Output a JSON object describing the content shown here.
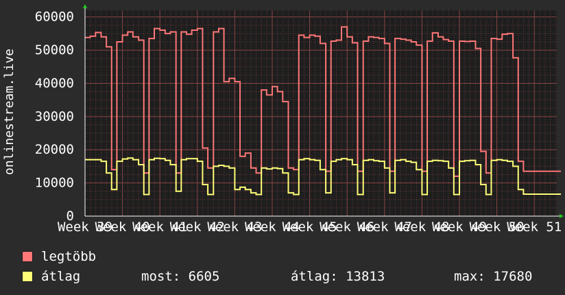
{
  "ylabel": "onlinestream.live",
  "x_tick_labels": [
    "Week 39",
    "Week 40",
    "Week 41",
    "Week 42",
    "Week 43",
    "Week 44",
    "Week 45",
    "Week 46",
    "Week 47",
    "Week 48",
    "Week 49",
    "Week 50",
    "Week 51"
  ],
  "legend": {
    "items": [
      {
        "label": "legtöbb",
        "color": "#ff7777"
      },
      {
        "label": "átlag",
        "color": "#ffff77"
      }
    ],
    "stats": {
      "now": "most: 6605",
      "avg": "átlag: 13813",
      "max": "max: 17680"
    }
  },
  "colors": {
    "background": "#2b2b2b",
    "plot_background": "#1e1e1e",
    "grid": "#6b3a3a",
    "text": "#ffffff",
    "axis_arrow": "#22cc22"
  },
  "chart_data": {
    "type": "line",
    "xlabel": "",
    "ylabel": "onlinestream.live",
    "ylim": [
      0,
      62000
    ],
    "xlim": [
      0,
      12.6
    ],
    "x_unit": "weeks since start of Week 39",
    "y_ticks": [
      0,
      10000,
      20000,
      30000,
      40000,
      50000,
      60000
    ],
    "grid": true,
    "legend_position": "bottom",
    "series": [
      {
        "name": "legtöbb",
        "color": "#ff7777",
        "x": [
          0.0,
          0.14,
          0.28,
          0.43,
          0.57,
          0.71,
          0.85,
          1.0,
          1.14,
          1.28,
          1.43,
          1.57,
          1.71,
          1.85,
          2.0,
          2.14,
          2.28,
          2.43,
          2.57,
          2.71,
          2.85,
          3.0,
          3.14,
          3.28,
          3.43,
          3.57,
          3.71,
          3.85,
          4.0,
          4.14,
          4.28,
          4.43,
          4.57,
          4.71,
          4.85,
          5.0,
          5.14,
          5.28,
          5.43,
          5.57,
          5.71,
          5.85,
          6.0,
          6.14,
          6.28,
          6.43,
          6.57,
          6.71,
          6.85,
          7.0,
          7.14,
          7.28,
          7.43,
          7.57,
          7.71,
          7.85,
          8.0,
          8.14,
          8.28,
          8.43,
          8.57,
          8.71,
          8.85,
          9.0,
          9.14,
          9.28,
          9.43,
          9.57,
          9.71,
          9.85,
          10.0,
          10.14,
          10.28,
          10.43,
          10.57,
          10.71,
          10.85,
          11.0,
          11.14,
          11.28,
          11.43,
          11.57,
          11.71,
          11.85,
          12.0,
          12.14,
          12.28,
          12.43,
          12.57
        ],
        "values": [
          53800,
          54200,
          55300,
          54000,
          51000,
          14000,
          52500,
          54500,
          55500,
          54000,
          53000,
          13000,
          53500,
          56500,
          56000,
          55000,
          55500,
          13000,
          55500,
          54800,
          56000,
          56500,
          20500,
          14500,
          55500,
          56500,
          40500,
          41500,
          40500,
          18000,
          19000,
          14500,
          13000,
          38000,
          36500,
          39000,
          37500,
          34500,
          14500,
          14000,
          54500,
          53800,
          54500,
          54200,
          52000,
          13500,
          52700,
          53000,
          57000,
          54000,
          52200,
          13500,
          52700,
          54000,
          53800,
          53500,
          52000,
          13500,
          53500,
          53300,
          53000,
          52500,
          51500,
          13500,
          52700,
          55200,
          54000,
          53200,
          52700,
          12000,
          52700,
          52600,
          52700,
          50500,
          19500,
          13000,
          53500,
          53300,
          54800,
          55000,
          47700,
          16500,
          13500,
          13500,
          13500,
          13500,
          13500,
          13500,
          13500
        ]
      },
      {
        "name": "átlag",
        "color": "#ffff77",
        "x": [
          0.0,
          0.14,
          0.28,
          0.43,
          0.57,
          0.71,
          0.85,
          1.0,
          1.14,
          1.28,
          1.43,
          1.57,
          1.71,
          1.85,
          2.0,
          2.14,
          2.28,
          2.43,
          2.57,
          2.71,
          2.85,
          3.0,
          3.14,
          3.28,
          3.43,
          3.57,
          3.71,
          3.85,
          4.0,
          4.14,
          4.28,
          4.43,
          4.57,
          4.71,
          4.85,
          5.0,
          5.14,
          5.28,
          5.43,
          5.57,
          5.71,
          5.85,
          6.0,
          6.14,
          6.28,
          6.43,
          6.57,
          6.71,
          6.85,
          7.0,
          7.14,
          7.28,
          7.43,
          7.57,
          7.71,
          7.85,
          8.0,
          8.14,
          8.28,
          8.43,
          8.57,
          8.71,
          8.85,
          9.0,
          9.14,
          9.28,
          9.43,
          9.57,
          9.71,
          9.85,
          10.0,
          10.14,
          10.28,
          10.43,
          10.57,
          10.71,
          10.85,
          11.0,
          11.14,
          11.28,
          11.43,
          11.57,
          11.71,
          11.85,
          12.0,
          12.14,
          12.28,
          12.43,
          12.57
        ],
        "values": [
          17000,
          17000,
          17000,
          16500,
          13000,
          8000,
          16500,
          17200,
          17500,
          17000,
          15500,
          6500,
          17000,
          17400,
          17300,
          16800,
          15500,
          7500,
          17000,
          17300,
          17300,
          16500,
          9500,
          6500,
          15000,
          15300,
          15000,
          14500,
          8000,
          8700,
          8000,
          7000,
          6500,
          14500,
          14200,
          14500,
          14300,
          13000,
          7000,
          6500,
          17000,
          17300,
          17000,
          16800,
          14000,
          7000,
          16500,
          17000,
          17300,
          17000,
          15500,
          6500,
          16800,
          17000,
          16700,
          16500,
          14500,
          7000,
          16800,
          17000,
          16500,
          16200,
          14000,
          6500,
          16500,
          16800,
          16700,
          16500,
          14500,
          6500,
          16500,
          16700,
          16800,
          15500,
          9500,
          6500,
          16800,
          17000,
          16800,
          16500,
          15000,
          8000,
          6605,
          6605,
          6605,
          6605,
          6605,
          6605,
          6605
        ]
      }
    ]
  }
}
